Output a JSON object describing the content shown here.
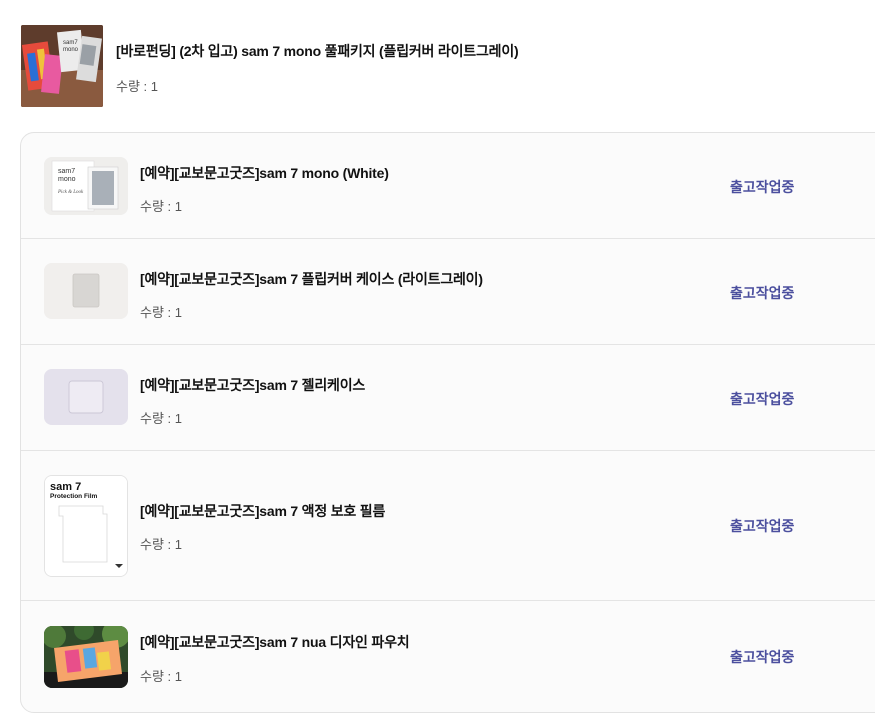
{
  "main_item": {
    "title": "[바로펀딩] (2차 입고) sam 7 mono 풀패키지 (플립커버 라이트그레이)",
    "quantity": "수량 : 1"
  },
  "sub_items": [
    {
      "title": "[예약][교보문고굿즈]sam 7 mono (White)",
      "quantity": "수량 : 1",
      "status": "출고작업중",
      "thumb": {
        "brand_line1": "sam7",
        "brand_line2": "mono",
        "script": "Pick & Look"
      }
    },
    {
      "title": "[예약][교보문고굿즈]sam 7 플립커버 케이스 (라이트그레이)",
      "quantity": "수량 : 1",
      "status": "출고작업중"
    },
    {
      "title": "[예약][교보문고굿즈]sam 7 젤리케이스",
      "quantity": "수량 : 1",
      "status": "출고작업중"
    },
    {
      "title": "[예약][교보문고굿즈]sam 7 액정 보호 필름",
      "quantity": "수량 : 1",
      "status": "출고작업중",
      "thumb": {
        "brand": "sam 7",
        "caption": "Protection Film"
      }
    },
    {
      "title": "[예약][교보문고굿즈]sam 7 nua 디자인 파우치",
      "quantity": "수량 : 1",
      "status": "출고작업중"
    }
  ],
  "colors": {
    "status": "#4b4f9e",
    "border": "#e2e2e2",
    "panel": "#fbfbfb"
  }
}
